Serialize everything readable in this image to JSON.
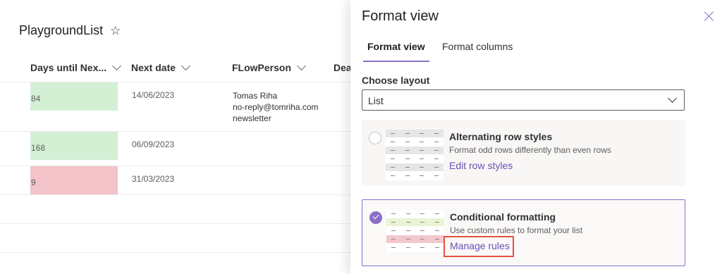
{
  "list": {
    "title": "PlaygroundList",
    "star_icon": "☆",
    "columns": [
      {
        "label": "Days until Nex..."
      },
      {
        "label": "Next date"
      },
      {
        "label": "FLowPerson"
      },
      {
        "label": "Dea"
      }
    ],
    "rows": [
      {
        "days": "84",
        "status": "green",
        "date": "14/06/2023",
        "person": [
          "Tomas Riha",
          "no-reply@tomriha.com",
          "newsletter"
        ]
      },
      {
        "days": "168",
        "status": "green",
        "date": "06/09/2023",
        "person": []
      },
      {
        "days": "9",
        "status": "red",
        "date": "31/03/2023",
        "person": []
      }
    ],
    "colors": {
      "green": "#d3f0d5",
      "red": "#f2c3c9"
    }
  },
  "panel": {
    "title": "Format view",
    "tabs": [
      {
        "label": "Format view",
        "active": true
      },
      {
        "label": "Format columns",
        "active": false
      }
    ],
    "layout": {
      "label": "Choose layout",
      "selected": "List"
    },
    "options": [
      {
        "title": "Alternating row styles",
        "description": "Format odd rows differently than even rows",
        "link": "Edit row styles",
        "selected": false
      },
      {
        "title": "Conditional formatting",
        "description": "Use custom rules to format your list",
        "link": "Manage rules",
        "selected": true
      }
    ],
    "accent_color": "#8a70c8",
    "highlight_color": "#e2543d"
  }
}
